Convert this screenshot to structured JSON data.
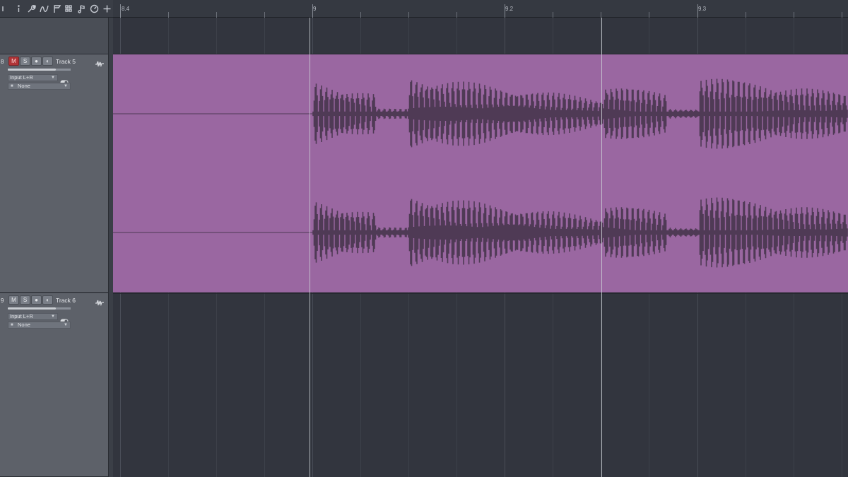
{
  "toolbar": {
    "tools": [
      {
        "name": "menu-icon"
      },
      {
        "name": "info-icon"
      },
      {
        "name": "wrench-icon"
      },
      {
        "name": "curve-icon"
      },
      {
        "name": "flag-icon"
      },
      {
        "name": "grid-icon"
      },
      {
        "name": "music-note-icon"
      },
      {
        "name": "clock-icon"
      },
      {
        "name": "add-icon"
      }
    ]
  },
  "ruler": {
    "labels": [
      "8.4",
      "9",
      "9.2",
      "9.3"
    ]
  },
  "tracks": [
    {
      "number": "8",
      "name": "Track 5",
      "mute_label": "M",
      "solo_label": "S",
      "muted": true,
      "input": "Input L+R",
      "output": "None"
    },
    {
      "number": "9",
      "name": "Track 6",
      "mute_label": "M",
      "solo_label": "S",
      "muted": false,
      "input": "Input L+R",
      "output": "None"
    }
  ],
  "colors": {
    "clip": "#9a67a1",
    "waveform": "#4f3a55",
    "mute_active": "#b03437"
  }
}
